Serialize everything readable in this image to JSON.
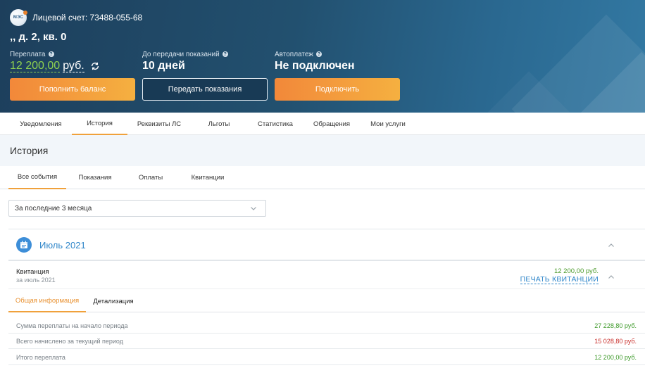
{
  "header": {
    "account_label": "Лицевой счет: 73488-055-68",
    "address": ",, д. 2, кв. 0",
    "logo_text": "МЭС",
    "stats": {
      "overpay": {
        "label": "Переплата",
        "value": "12 200,00",
        "currency": "руб."
      },
      "meter_deadline": {
        "label": "До передачи показаний",
        "value": "10 дней"
      },
      "autopay": {
        "label": "Автоплатеж",
        "value": "Не подключен"
      }
    },
    "buttons": {
      "top_up": "Пополнить баланс",
      "submit_readings": "Передать показания",
      "connect": "Подключить"
    }
  },
  "top_tabs": [
    "Уведомления",
    "История",
    "Реквизиты ЛС",
    "Льготы",
    "Статистика",
    "Обращения",
    "Мои услуги"
  ],
  "active_top_tab": "История",
  "section_title": "История",
  "sub_tabs": [
    "Все события",
    "Показания",
    "Оплаты",
    "Квитанции"
  ],
  "active_sub_tab": "Все события",
  "period_select": {
    "value": "За последние 3 месяца"
  },
  "month_group": {
    "label": "Июль 2021",
    "receipt": {
      "title": "Квитанция",
      "subtitle": "за июль 2021",
      "amount": "12 200,00 руб.",
      "print_link": "ПЕЧАТЬ КВИТАНЦИИ"
    },
    "inner_tabs": [
      "Общая информация",
      "Детализация"
    ],
    "active_inner_tab": "Общая информация",
    "lines": [
      {
        "label": "Сумма переплаты на начало периода",
        "value": "27 228,80 руб.",
        "color": "green"
      },
      {
        "label": "Всего начислено за текущий период",
        "value": "15 028,80 руб.",
        "color": "red"
      },
      {
        "label": "Итого переплата",
        "value": "12 200,00 руб.",
        "color": "green"
      }
    ]
  },
  "colors": {
    "accent_orange": "#f0a13b",
    "link_blue": "#2f86c9",
    "balance_green": "#8fd14f",
    "header_dark": "#1d3f5c"
  }
}
